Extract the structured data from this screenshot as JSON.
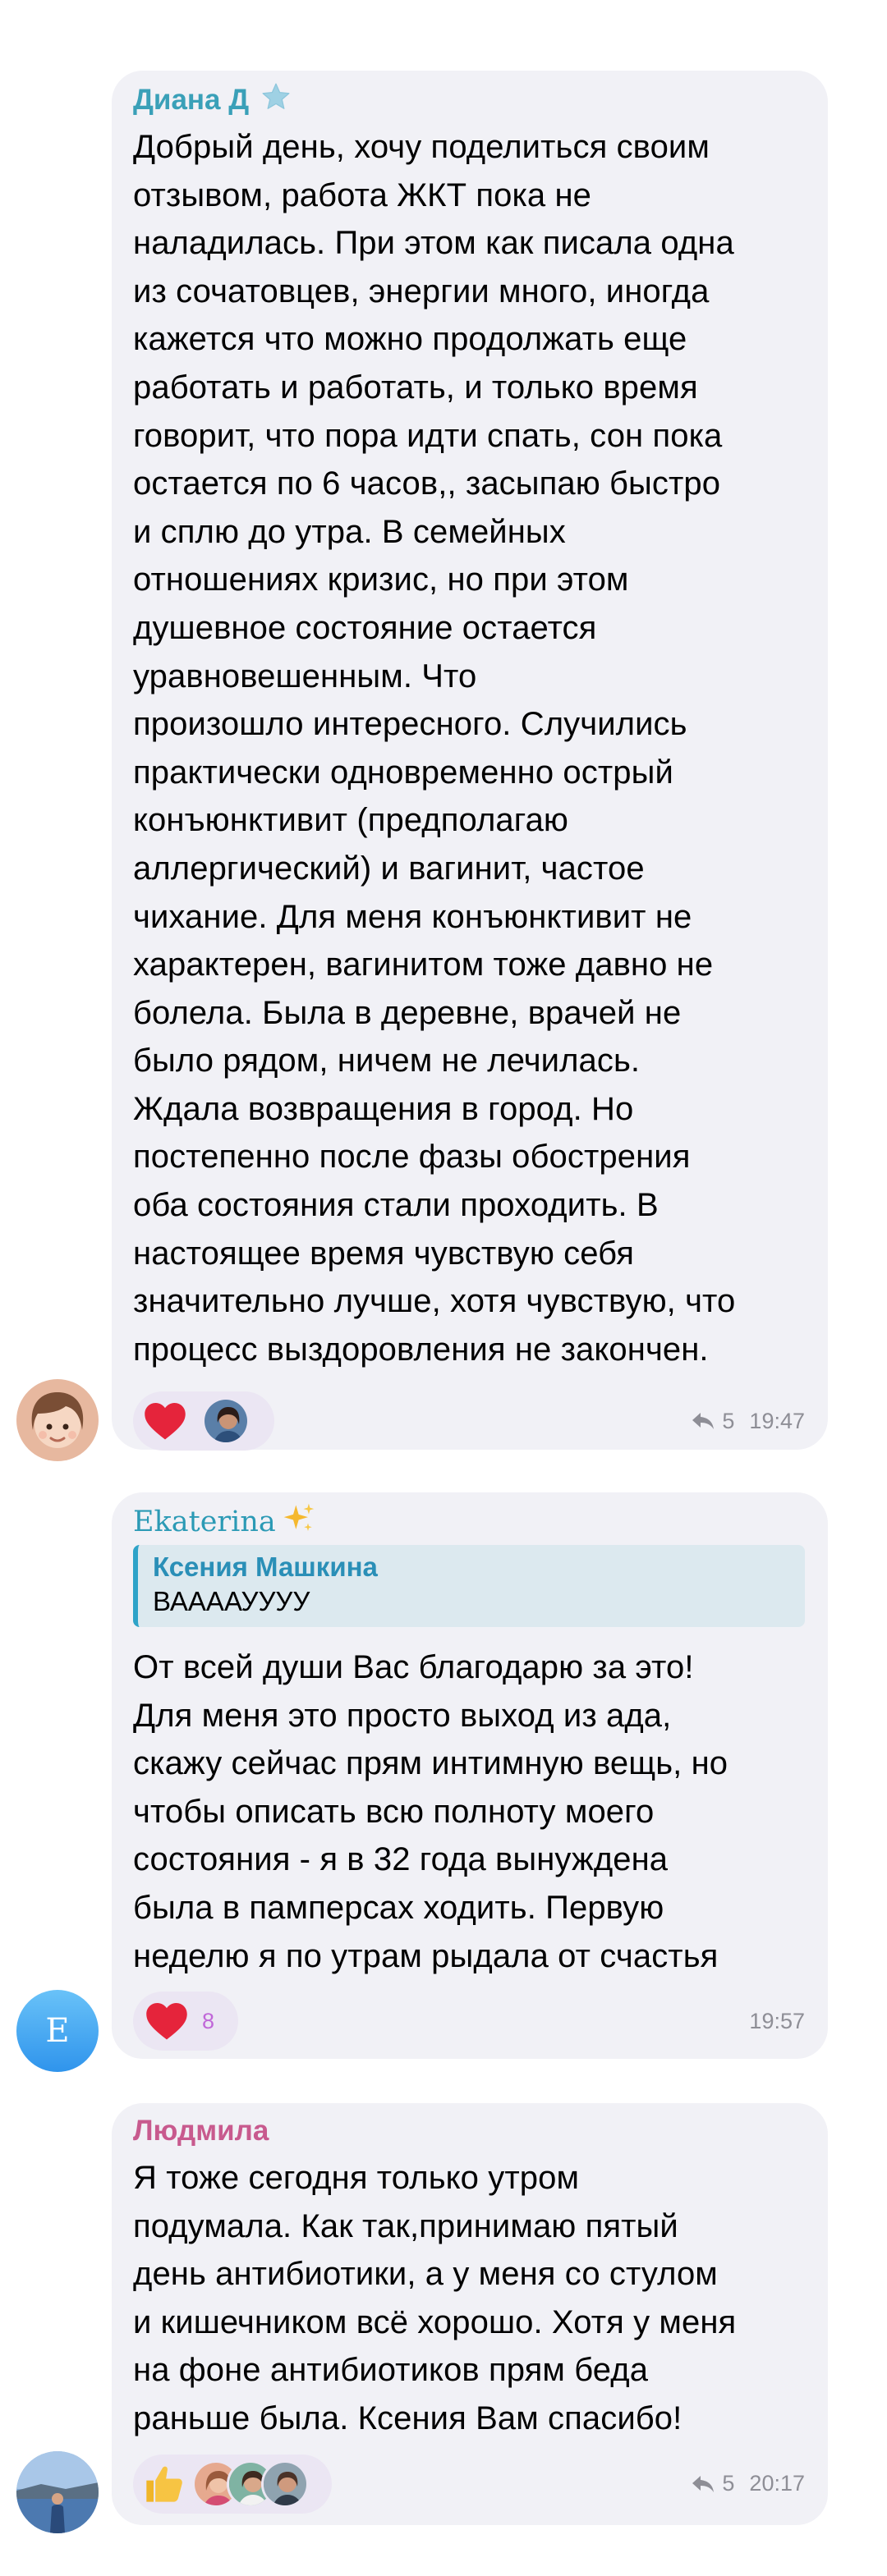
{
  "messages": [
    {
      "sender": "Диана Д",
      "sender_color": "#3aa0b8",
      "text": "Добрый день, хочу поделиться своим\nотзывом, работа ЖКТ пока не\nналадилась. При этом как писала одна\nиз сочатовцев, энергии много, иногда\nкажется что можно продолжать еще\nработать и работать, и только время\nговорит, что пора идти спать, сон пока\nостается по 6 часов,, засыпаю быстро\nи сплю до утра. В семейных\nотношениях кризис, но при этом\nдушевное состояние остается\nуравновешенным. Что\nпроизошло интересного. Случились\nпрактически одновременно острый\nконъюнктивит (предполагаю\nаллергический)  и вагинит, частое\nчихание.  Для меня конъюнктивит не\nхарактерен, вагинитом тоже давно не\nболела. Была в деревне, врачей не\nбыло рядом, ничем не лечилась.\nЖдала возвращения в город. Но\nпостепенно после фазы обострения\nоба состояния стали  проходить. В\nнастоящее время чувствую себя\nзначительно лучше, хотя чувствую, что\nпроцесс выздоровления не закончен.",
      "reaction": "heart",
      "reply_count": "5",
      "time": "19:47"
    },
    {
      "sender": "Ekaterina",
      "sender_color": "#2b9ab5",
      "sender_emoji": "✨",
      "quote_author": "Ксения Машкина",
      "quote_text": "ВААААУУУУ",
      "text": "От всей души Вас благодарю за это!\nДля меня это просто выход из ада,\nскажу сейчас прям интимную вещь, но\nчтобы описать всю полноту моего\nсостояния - я в 32 года вынуждена\nбыла в памперсах ходить. Первую\nнеделю я по утрам рыдала от счастья",
      "reaction": "heart",
      "reaction_count": "8",
      "time": "19:57",
      "avatar_letter": "E"
    },
    {
      "sender": "Людмила",
      "sender_color": "#c85a8e",
      "text": "Я тоже сегодня только утром\nподумала. Как так,принимаю пятый\nдень антибиотики, а у меня со стулом\nи кишечником всё хорошо. Хотя у меня\nна фоне антибиотиков прям беда\nраньше была. Ксения Вам спасибо!",
      "reaction": "thumbs-up",
      "reply_count": "5",
      "time": "20:17"
    }
  ],
  "colors": {
    "bubble": "#f1f1f6",
    "meta": "#8e8e96",
    "reaction_pill": "#ebe6f3",
    "heart": "#e5243b",
    "count_purple": "#c067d8"
  }
}
